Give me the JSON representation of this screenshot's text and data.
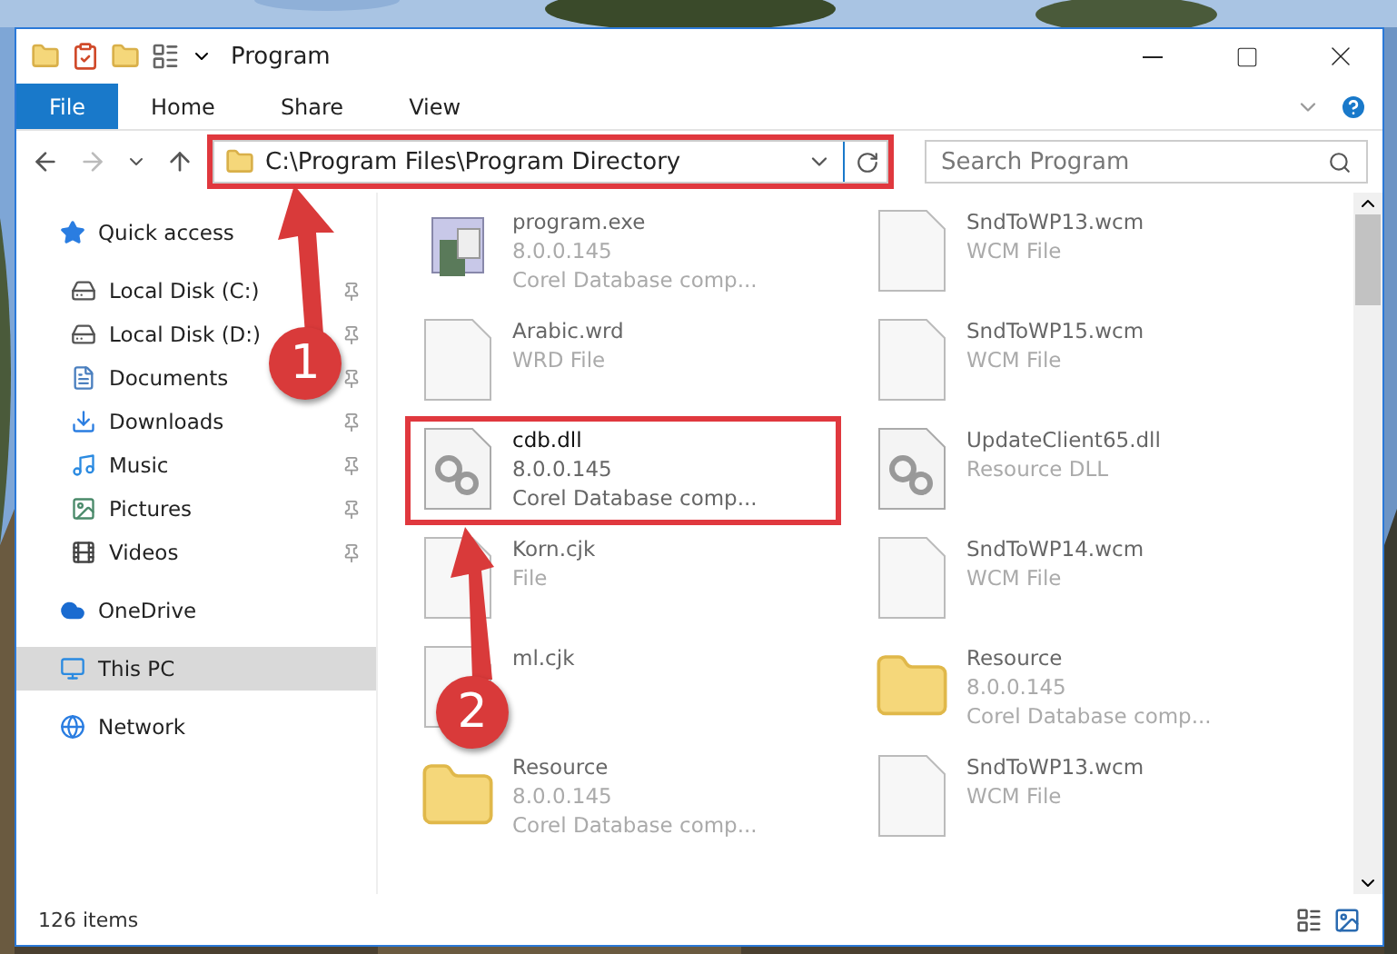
{
  "window": {
    "title": "Program"
  },
  "ribbon": {
    "file_button": "File",
    "tabs": [
      {
        "label": "Home"
      },
      {
        "label": "Share"
      },
      {
        "label": "View"
      }
    ]
  },
  "address": {
    "path": "C:\\Program Files\\Program Directory",
    "highlighted": true
  },
  "search": {
    "placeholder": "Search Program"
  },
  "sidebar": {
    "items": [
      {
        "label": "Quick access",
        "kind": "star",
        "pinned": false,
        "selected": false,
        "children": [
          {
            "label": "Local Disk (C:)",
            "kind": "disk",
            "pinned": true,
            "selected": false
          },
          {
            "label": "Local Disk (D:)",
            "kind": "disk",
            "pinned": true,
            "selected": false
          },
          {
            "label": "Documents",
            "kind": "documents",
            "pinned": true,
            "selected": false
          },
          {
            "label": "Downloads",
            "kind": "downloads",
            "pinned": true,
            "selected": false
          },
          {
            "label": "Music",
            "kind": "music",
            "pinned": true,
            "selected": false
          },
          {
            "label": "Pictures",
            "kind": "pictures",
            "pinned": true,
            "selected": false
          },
          {
            "label": "Videos",
            "kind": "videos",
            "pinned": true,
            "selected": false
          }
        ]
      },
      {
        "label": "OneDrive",
        "kind": "cloud",
        "pinned": false,
        "selected": false
      },
      {
        "label": "This PC",
        "kind": "pc",
        "pinned": false,
        "selected": true
      },
      {
        "label": "Network",
        "kind": "network",
        "pinned": false,
        "selected": false
      }
    ]
  },
  "files": [
    {
      "name": "program.exe",
      "kind": "app",
      "lines": [
        "8.0.0.145",
        "Corel Database comp..."
      ],
      "highlighted": false
    },
    {
      "name": "Arabic.wrd",
      "kind": "file",
      "lines": [
        "WRD File"
      ],
      "highlighted": false
    },
    {
      "name": "cdb.dll",
      "kind": "dll",
      "lines": [
        "8.0.0.145",
        "Corel Database comp..."
      ],
      "highlighted": true
    },
    {
      "name": "Korn.cjk",
      "kind": "file",
      "lines": [
        "File"
      ],
      "highlighted": false
    },
    {
      "name": "ml.cjk",
      "kind": "file",
      "highlighted": false
    },
    {
      "name": "Resource",
      "kind": "folder",
      "lines": [
        "8.0.0.145",
        "Corel Database comp..."
      ],
      "highlighted": false
    },
    {
      "name": "SndToWP13.wcm",
      "kind": "file",
      "lines": [
        "WCM File"
      ],
      "highlighted": false
    },
    {
      "name": "SndToWP15.wcm",
      "kind": "file",
      "lines": [
        "WCM File"
      ],
      "highlighted": false
    },
    {
      "name": "UpdateClient65.dll",
      "kind": "dll",
      "lines": [
        "Resource DLL"
      ],
      "highlighted": false
    },
    {
      "name": "SndToWP14.wcm",
      "kind": "file",
      "lines": [
        "WCM File"
      ],
      "highlighted": false
    },
    {
      "name": "Resource",
      "kind": "folder",
      "lines": [
        "8.0.0.145",
        "Corel Database comp..."
      ],
      "highlighted": false
    },
    {
      "name": "SndToWP13.wcm",
      "kind": "file",
      "lines": [
        "WCM File"
      ],
      "highlighted": false
    }
  ],
  "status_bar": {
    "count": "126 items"
  },
  "annotations": [
    {
      "number": "1"
    },
    {
      "number": "2"
    }
  ]
}
